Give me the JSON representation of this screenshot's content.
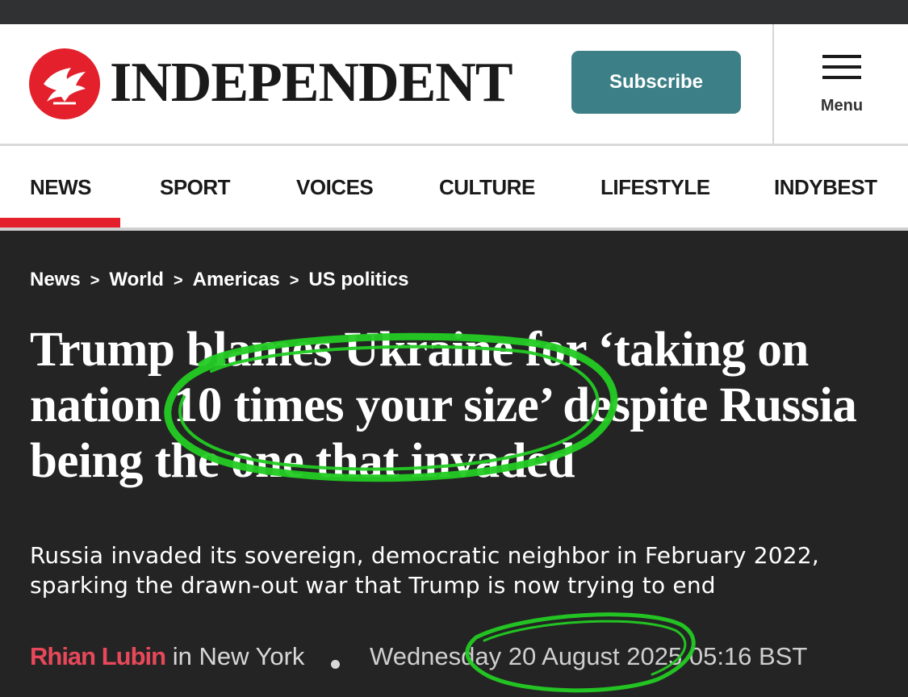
{
  "header": {
    "brand": "INDEPENDENT",
    "subscribe_label": "Subscribe",
    "menu_label": "Menu",
    "logo_icon": "eagle-icon",
    "brand_color": "#e3202b",
    "subscribe_color": "#3c7f86"
  },
  "nav": {
    "items": [
      {
        "label": "NEWS",
        "active": true
      },
      {
        "label": "SPORT"
      },
      {
        "label": "VOICES"
      },
      {
        "label": "CULTURE"
      },
      {
        "label": "LIFESTYLE"
      },
      {
        "label": "INDYBEST"
      }
    ]
  },
  "breadcrumb": {
    "items": [
      "News",
      "World",
      "Americas",
      "US politics"
    ],
    "separator": ">"
  },
  "article": {
    "headline": "Trump blames Ukraine for ‘taking on nation 10 times your size’ despite Russia being the one that invaded",
    "standfirst": "Russia invaded its sovereign, democratic neighbor in February 2022, sparking the drawn-out war that Trump is now trying to end",
    "author": "Rhian Lubin",
    "location": "in New York",
    "date": "Wednesday 20 August 2025 05:16 BST",
    "author_color": "#e8485a",
    "highlight_color": "#22cc22"
  }
}
